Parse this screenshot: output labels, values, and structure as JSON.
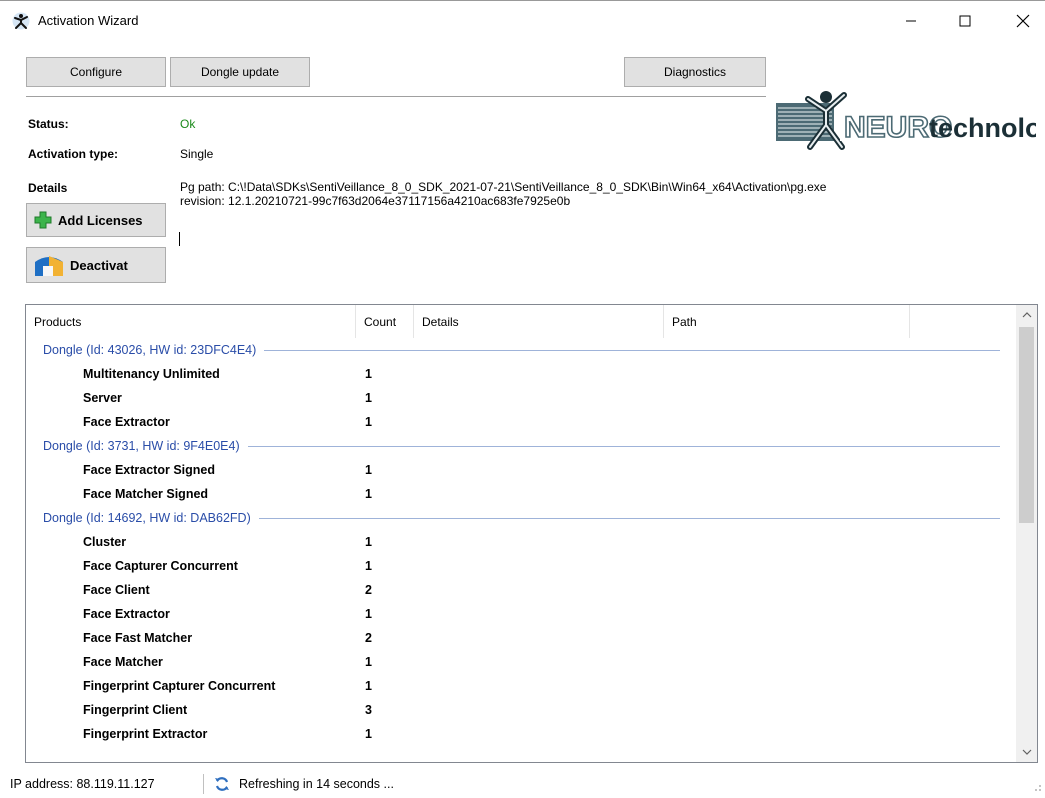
{
  "window": {
    "title": "Activation Wizard",
    "icon": "neurotechnology-app-icon",
    "controls": [
      "minimize-icon",
      "maximize-icon",
      "close-icon"
    ]
  },
  "toolbar": {
    "configure_label": "Configure",
    "dongle_update_label": "Dongle update",
    "diagnostics_label": "Diagnostics"
  },
  "logo": {
    "text_neuro": "NEURO",
    "text_technology": "technology"
  },
  "info": {
    "status_label": "Status:",
    "status_value": "Ok",
    "status_color": "#1a8a1a",
    "activation_type_label": "Activation type:",
    "activation_type_value": "Single",
    "details_label": "Details",
    "details_line1": "Pg path: C:\\!Data\\SDKs\\SentiVeillance_8_0_SDK_2021-07-21\\SentiVeillance_8_0_SDK\\Bin\\Win64_x64\\Activation\\pg.exe",
    "details_line2": "revision: 12.1.20210721-99c7f63d2064e37117156a4210ac683fe7925e0b"
  },
  "actions": {
    "add_licenses_label": "Add Licenses",
    "deactivate_label": "Deactivat"
  },
  "table": {
    "columns": [
      "Products",
      "Count",
      "Details",
      "Path",
      ""
    ],
    "groups": [
      {
        "header": "Dongle (Id: 43026, HW id: 23DFC4E4)",
        "items": [
          {
            "name": "Multitenancy Unlimited",
            "count": "1"
          },
          {
            "name": "Server",
            "count": "1"
          },
          {
            "name": "Face Extractor",
            "count": "1"
          }
        ]
      },
      {
        "header": "Dongle (Id: 3731, HW id: 9F4E0E4)",
        "items": [
          {
            "name": "Face Extractor Signed",
            "count": "1"
          },
          {
            "name": "Face Matcher Signed",
            "count": "1"
          }
        ]
      },
      {
        "header": "Dongle (Id: 14692, HW id: DAB62FD)",
        "items": [
          {
            "name": "Cluster",
            "count": "1"
          },
          {
            "name": "Face Capturer Concurrent",
            "count": "1"
          },
          {
            "name": "Face Client",
            "count": "2"
          },
          {
            "name": "Face Extractor",
            "count": "1"
          },
          {
            "name": "Face Fast Matcher",
            "count": "2"
          },
          {
            "name": "Face Matcher",
            "count": "1"
          },
          {
            "name": "Fingerprint Capturer Concurrent",
            "count": "1"
          },
          {
            "name": "Fingerprint Client",
            "count": "3"
          },
          {
            "name": "Fingerprint Extractor",
            "count": "1"
          }
        ]
      }
    ]
  },
  "statusbar": {
    "ip_text": "IP address:  88.119.11.127",
    "refresh_text": "Refreshing in 14 seconds ..."
  },
  "colors": {
    "accent_blue": "#2a4da8",
    "button_bg": "#e1e1e1",
    "ok_green": "#1a8a1a"
  }
}
